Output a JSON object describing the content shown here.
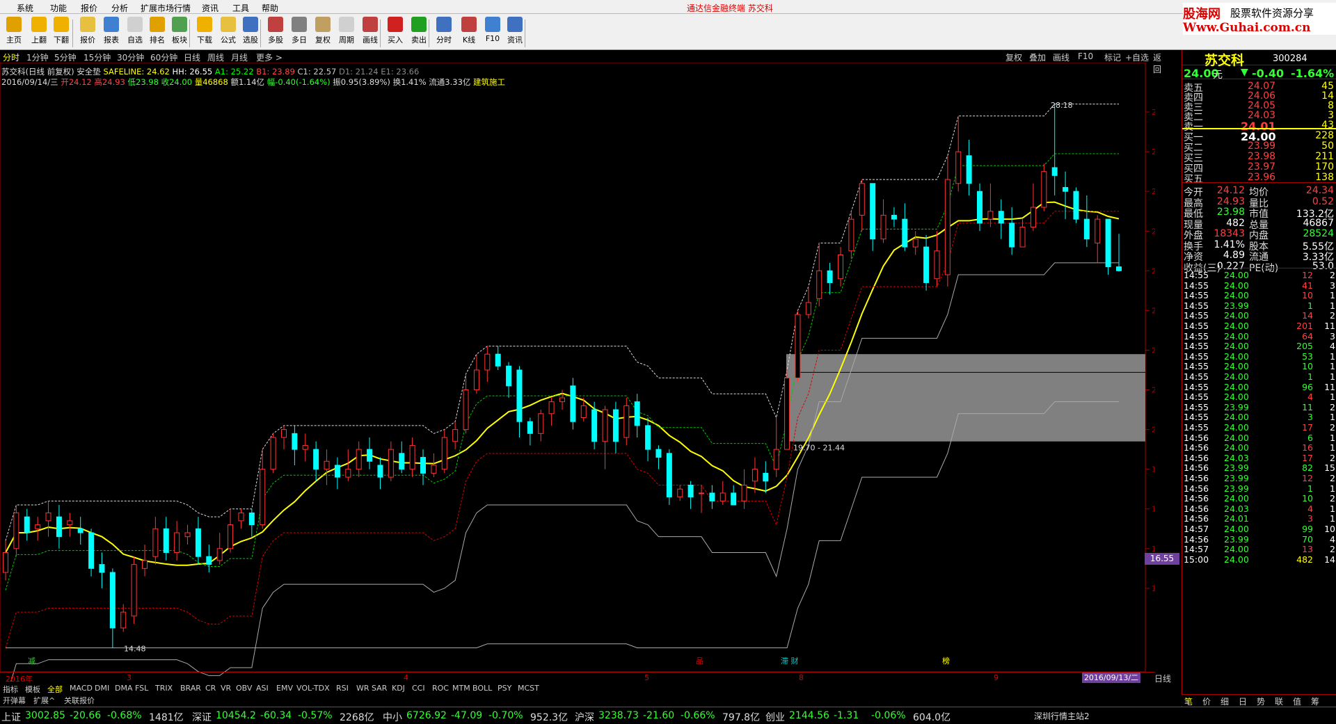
{
  "menu": [
    "系统",
    "功能",
    "报价",
    "分析",
    "扩展市场行情",
    "资讯",
    "工具",
    "帮助"
  ],
  "window_title": "通达信金融终端    苏交科",
  "toolbar": [
    {
      "label": "主页",
      "icon": "home-icon",
      "color": "#e0a000"
    },
    {
      "label": "上翻",
      "icon": "arrow-up-icon",
      "color": "#f0b000"
    },
    {
      "label": "下翻",
      "icon": "arrow-down-icon",
      "color": "#f0b000"
    },
    {
      "label": "报价",
      "icon": "yen-icon",
      "color": "#e8c040"
    },
    {
      "label": "报表",
      "icon": "report-icon",
      "color": "#4080d0"
    },
    {
      "label": "自选",
      "icon": "f6-icon",
      "color": "#d0d0d0"
    },
    {
      "label": "排名",
      "icon": "rank-icon",
      "color": "#e0a000"
    },
    {
      "label": "板块",
      "icon": "blocks-icon",
      "color": "#50a050"
    },
    {
      "label": "下载",
      "icon": "download-icon",
      "color": "#f0b000"
    },
    {
      "label": "公式",
      "icon": "formula-icon",
      "color": "#e8c040"
    },
    {
      "label": "选股",
      "icon": "select-stock-icon",
      "color": "#4070c0"
    },
    {
      "label": "多股",
      "icon": "multi-stock-icon",
      "color": "#c04040"
    },
    {
      "label": "多日",
      "icon": "multi-day-icon",
      "color": "#808080"
    },
    {
      "label": "复权",
      "icon": "adjust-icon",
      "color": "#c0a060"
    },
    {
      "label": "周期",
      "icon": "f8-icon",
      "color": "#d0d0d0"
    },
    {
      "label": "画线",
      "icon": "draw-line-icon",
      "color": "#c04040"
    },
    {
      "label": "买入",
      "icon": "buy-icon",
      "color": "#d02020"
    },
    {
      "label": "卖出",
      "icon": "sell-icon",
      "color": "#20a020"
    },
    {
      "label": "分时",
      "icon": "intraday-icon",
      "color": "#4070c0"
    },
    {
      "label": "K线",
      "icon": "kline-icon",
      "color": "#c04040"
    },
    {
      "label": "F10",
      "icon": "f10-icon",
      "color": "#4080d0"
    },
    {
      "label": "资讯",
      "icon": "news-icon",
      "color": "#4070c0"
    }
  ],
  "logo": {
    "line1": "股海网",
    "line1b": "股票软件资源分享",
    "line2": "Www.Guhai.com.cn"
  },
  "periods": [
    "分时",
    "1分钟",
    "5分钟",
    "15分钟",
    "30分钟",
    "60分钟",
    "日线",
    "周线",
    "月线",
    "更多 >"
  ],
  "active_period": "分时",
  "right_tools": [
    "复权",
    "叠加",
    "画线",
    "F10",
    "标记",
    "+自选",
    "返回"
  ],
  "info": {
    "line1_name": "苏交科(日线 前复权) 安全垫",
    "line1_safeline": "SAFELINE: 24.62",
    "line1_hh": "HH: 26.55",
    "line1_a1": "A1: 25.22",
    "line1_b1": "B1: 23.89",
    "line1_c1": "C1: 22.57",
    "line1_d1": "D1: 21.24",
    "line1_e1": "E1: 23.66",
    "line2_date": "2016/09/14/三",
    "line2_open": "开24.12",
    "line2_high": "高24.93",
    "line2_low": "低23.98",
    "line2_close": "收24.00",
    "line2_vol": "量46868",
    "line2_amt": "额1.14亿",
    "line2_chg": "幅-0.40(-1.64%)",
    "line2_amp": "振0.95(3.89%)",
    "line2_turn": "换1.41%",
    "line2_float": "流通3.33亿",
    "line2_sector": "建筑施工"
  },
  "chart_data": {
    "type": "candlestick",
    "ylim": [
      14,
      29
    ],
    "y_ticks": [
      "16.00",
      "17.00",
      "18.00",
      "19.00",
      "20.00",
      "21.00",
      "22.00",
      "23.00",
      "24.00",
      "25.00",
      "26.00",
      "27.00",
      "28.00"
    ],
    "annotations": [
      "28.18",
      "14.48",
      "19.70 - 21.44"
    ],
    "current_price_tag": "16.55",
    "x_labels": [
      "2016年",
      "3",
      "4",
      "5",
      "8",
      "9"
    ],
    "event_marks": [
      "减",
      "品",
      "滞 财",
      "榜"
    ],
    "end_date": "2016/09/13/二",
    "candles": [
      [
        16.4,
        16.9,
        16.2,
        17.2
      ],
      [
        17.0,
        17.9,
        16.8,
        18.1
      ],
      [
        17.8,
        17.4,
        17.2,
        18.0
      ],
      [
        17.5,
        17.6,
        17.2,
        17.8
      ],
      [
        17.7,
        17.9,
        17.3,
        18.2
      ],
      [
        17.8,
        17.3,
        17.0,
        18.1
      ],
      [
        17.6,
        17.7,
        17.3,
        17.9
      ],
      [
        17.5,
        17.4,
        17.1,
        17.8
      ],
      [
        17.4,
        16.5,
        16.3,
        17.5
      ],
      [
        16.6,
        16.4,
        16.0,
        16.9
      ],
      [
        16.4,
        15.0,
        14.5,
        16.5
      ],
      [
        15.0,
        15.4,
        14.9,
        15.6
      ],
      [
        15.3,
        16.6,
        15.1,
        16.8
      ],
      [
        16.5,
        16.7,
        16.3,
        17.1
      ],
      [
        16.8,
        17.5,
        16.6,
        17.8
      ],
      [
        17.5,
        16.9,
        16.7,
        17.8
      ],
      [
        16.9,
        17.4,
        16.7,
        17.7
      ],
      [
        17.3,
        17.4,
        17.1,
        17.6
      ],
      [
        17.5,
        16.8,
        16.6,
        17.8
      ],
      [
        16.8,
        16.6,
        16.4,
        17.1
      ],
      [
        16.7,
        17.0,
        16.6,
        17.4
      ],
      [
        17.0,
        17.6,
        16.9,
        18.0
      ],
      [
        17.7,
        17.9,
        17.5,
        18.0
      ],
      [
        17.9,
        17.6,
        17.3,
        18.0
      ],
      [
        17.6,
        19.0,
        17.5,
        19.5
      ],
      [
        19.0,
        19.8,
        18.9,
        19.9
      ],
      [
        19.8,
        20.0,
        19.5,
        20.1
      ],
      [
        19.9,
        19.5,
        19.1,
        20.1
      ],
      [
        19.5,
        19.6,
        19.2,
        19.9
      ],
      [
        19.5,
        19.0,
        18.7,
        19.7
      ],
      [
        19.0,
        19.2,
        18.6,
        19.5
      ],
      [
        19.1,
        18.8,
        18.5,
        19.3
      ],
      [
        18.8,
        19.0,
        18.7,
        19.5
      ],
      [
        19.0,
        19.5,
        18.8,
        19.7
      ],
      [
        19.5,
        19.2,
        19.0,
        19.8
      ],
      [
        19.1,
        18.8,
        18.5,
        19.3
      ],
      [
        18.8,
        19.5,
        18.7,
        19.7
      ],
      [
        19.4,
        19.0,
        18.9,
        19.7
      ],
      [
        19.0,
        19.6,
        18.8,
        19.8
      ],
      [
        19.3,
        18.9,
        18.6,
        19.5
      ],
      [
        18.9,
        19.1,
        18.8,
        19.4
      ],
      [
        19.0,
        19.8,
        18.9,
        20.0
      ],
      [
        19.7,
        20.0,
        19.5,
        20.2
      ],
      [
        20.0,
        21.0,
        19.9,
        21.4
      ],
      [
        21.0,
        21.5,
        20.9,
        21.9
      ],
      [
        21.5,
        21.9,
        21.2,
        22.1
      ],
      [
        21.9,
        21.6,
        21.5,
        22.1
      ],
      [
        21.6,
        21.1,
        20.8,
        21.7
      ],
      [
        21.5,
        20.2,
        19.8,
        21.6
      ],
      [
        20.2,
        19.9,
        19.6,
        20.3
      ],
      [
        19.9,
        20.4,
        19.7,
        20.5
      ],
      [
        20.4,
        20.7,
        20.1,
        20.8
      ],
      [
        20.7,
        20.8,
        20.5,
        21.0
      ],
      [
        21.1,
        20.2,
        20.0,
        21.3
      ],
      [
        20.3,
        20.6,
        20.2,
        20.8
      ],
      [
        20.5,
        19.7,
        19.5,
        20.7
      ],
      [
        19.7,
        20.5,
        19.0,
        20.6
      ],
      [
        20.5,
        19.7,
        19.4,
        20.7
      ],
      [
        19.8,
        20.6,
        19.6,
        20.8
      ],
      [
        20.7,
        20.1,
        19.8,
        20.9
      ],
      [
        20.1,
        19.5,
        19.2,
        20.3
      ],
      [
        19.5,
        19.3,
        19.0,
        19.6
      ],
      [
        19.4,
        18.3,
        18.1,
        19.5
      ],
      [
        18.3,
        18.5,
        18.2,
        18.6
      ],
      [
        18.6,
        18.3,
        18.0,
        18.7
      ],
      [
        18.4,
        18.4,
        17.9,
        18.6
      ],
      [
        18.4,
        18.2,
        18.0,
        18.6
      ],
      [
        18.2,
        18.4,
        18.1,
        18.7
      ],
      [
        18.4,
        18.1,
        18.1,
        18.6
      ],
      [
        18.2,
        18.6,
        18.0,
        19.0
      ],
      [
        18.7,
        19.0,
        18.4,
        19.3
      ],
      [
        18.9,
        18.7,
        18.4,
        19.2
      ],
      [
        19.0,
        19.5,
        18.8,
        20.3
      ],
      [
        19.5,
        21.3,
        19.5,
        21.5
      ],
      [
        21.3,
        22.9,
        21.2,
        23.0
      ],
      [
        22.9,
        23.2,
        22.8,
        23.6
      ],
      [
        23.3,
        24.0,
        23.1,
        24.7
      ],
      [
        24.0,
        23.7,
        23.4,
        24.2
      ],
      [
        23.8,
        24.4,
        23.6,
        24.6
      ],
      [
        24.5,
        25.3,
        24.3,
        25.5
      ],
      [
        25.4,
        26.2,
        25.0,
        26.3
      ],
      [
        26.2,
        24.8,
        24.5,
        26.2
      ],
      [
        24.8,
        25.4,
        24.7,
        25.8
      ],
      [
        25.4,
        25.3,
        25.1,
        25.6
      ],
      [
        25.3,
        24.6,
        24.5,
        25.7
      ],
      [
        24.6,
        24.8,
        24.4,
        25.0
      ],
      [
        24.6,
        23.7,
        23.5,
        24.9
      ],
      [
        23.8,
        24.5,
        23.6,
        25.0
      ],
      [
        23.9,
        26.3,
        23.6,
        26.9
      ],
      [
        26.2,
        27.0,
        26.0,
        27.9
      ],
      [
        26.9,
        26.2,
        25.9,
        27.3
      ],
      [
        26.0,
        25.2,
        25.0,
        26.2
      ],
      [
        25.3,
        25.5,
        25.1,
        26.2
      ],
      [
        25.5,
        25.2,
        24.8,
        25.8
      ],
      [
        25.2,
        24.6,
        24.4,
        25.6
      ],
      [
        24.6,
        25.1,
        24.6,
        25.3
      ],
      [
        25.1,
        25.6,
        25.0,
        26.2
      ],
      [
        25.6,
        26.5,
        25.5,
        26.7
      ],
      [
        26.6,
        26.4,
        25.9,
        28.2
      ],
      [
        26.1,
        26.0,
        25.3,
        26.5
      ],
      [
        26.0,
        25.3,
        25.2,
        26.1
      ],
      [
        25.3,
        24.8,
        24.6,
        25.9
      ],
      [
        24.7,
        25.3,
        24.2,
        25.4
      ],
      [
        25.3,
        24.1,
        23.9,
        25.3
      ],
      [
        24.1,
        24.0,
        23.98,
        24.93
      ]
    ]
  },
  "indicators": [
    "指标",
    "模板",
    "全部",
    "MACD",
    "DMI",
    "DMA",
    "FSL",
    "TRIX",
    "BRAR",
    "CR",
    "VR",
    "OBV",
    "ASI",
    "EMV",
    "VOL-TDX",
    "RSI",
    "WR",
    "SAR",
    "KDJ",
    "CCI",
    "ROC",
    "MTM",
    "BOLL",
    "PSY",
    "MCST"
  ],
  "tabs2": [
    "开弹幕",
    "扩展^",
    "关联报价"
  ],
  "status": [
    {
      "name": "上证",
      "val": "3002.85",
      "chg": "-20.66",
      "pct": "-0.68%",
      "amt": "1481亿"
    },
    {
      "name": "深证",
      "val": "10454.2",
      "chg": "-60.34",
      "pct": "-0.57%",
      "amt": "2268亿"
    },
    {
      "name": "中小",
      "val": "6726.92",
      "chg": "-47.09",
      "pct": "-0.70%",
      "amt": "952.3亿"
    },
    {
      "name": "沪深",
      "val": "3238.73",
      "chg": "-21.60",
      "pct": "-0.66%",
      "amt": "797.8亿"
    },
    {
      "name": "创业",
      "val": "2144.56",
      "chg": "-1.31",
      "pct": "-0.06%",
      "amt": "604.0亿"
    }
  ],
  "server": "深圳行情主站2",
  "stock": {
    "name": "苏交科",
    "code": "300284",
    "price": "24.00",
    "unit": "元",
    "chg": "-0.40",
    "pct": "-1.64%"
  },
  "asks": [
    {
      "label": "卖五",
      "price": "24.07",
      "vol": "45"
    },
    {
      "label": "卖四",
      "price": "24.06",
      "vol": "14"
    },
    {
      "label": "卖三",
      "price": "24.05",
      "vol": "8"
    },
    {
      "label": "卖二",
      "price": "24.03",
      "vol": "3"
    },
    {
      "label": "卖一",
      "price": "24.01",
      "vol": "43"
    }
  ],
  "bids": [
    {
      "label": "买一",
      "price": "24.00",
      "vol": "228"
    },
    {
      "label": "买二",
      "price": "23.99",
      "vol": "50"
    },
    {
      "label": "买三",
      "price": "23.98",
      "vol": "211"
    },
    {
      "label": "买四",
      "price": "23.97",
      "vol": "170"
    },
    {
      "label": "买五",
      "price": "23.96",
      "vol": "138"
    }
  ],
  "stats": [
    {
      "l1": "今开",
      "v1": "24.12",
      "c1": "red",
      "l2": "均价",
      "v2": "24.34",
      "c2": "red"
    },
    {
      "l1": "最高",
      "v1": "24.93",
      "c1": "red",
      "l2": "量比",
      "v2": "0.52",
      "c2": "red"
    },
    {
      "l1": "最低",
      "v1": "23.98",
      "c1": "grn",
      "l2": "市值",
      "v2": "133.2亿",
      "c2": "wht"
    },
    {
      "l1": "现量",
      "v1": "482",
      "c1": "wht",
      "l2": "总量",
      "v2": "46867",
      "c2": "wht"
    },
    {
      "l1": "外盘",
      "v1": "18343",
      "c1": "red",
      "l2": "内盘",
      "v2": "28524",
      "c2": "grn"
    },
    {
      "l1": "换手",
      "v1": "1.41%",
      "c1": "wht",
      "l2": "股本",
      "v2": "5.55亿",
      "c2": "wht"
    },
    {
      "l1": "净资",
      "v1": "4.89",
      "c1": "wht",
      "l2": "流通",
      "v2": "3.33亿",
      "c2": "wht"
    },
    {
      "l1": "收益(三)",
      "v1": "0.227",
      "c1": "wht",
      "l2": "PE(动)",
      "v2": "53.0",
      "c2": "wht"
    }
  ],
  "ticks": [
    [
      "14:55",
      "24.00",
      "12",
      "2",
      "grn",
      "red"
    ],
    [
      "14:55",
      "24.00",
      "41",
      "3",
      "grn",
      "red"
    ],
    [
      "14:55",
      "24.00",
      "10",
      "1",
      "grn",
      "red"
    ],
    [
      "14:55",
      "23.99",
      "1",
      "1",
      "grn",
      "grn"
    ],
    [
      "14:55",
      "24.00",
      "14",
      "2",
      "grn",
      "red"
    ],
    [
      "14:55",
      "24.00",
      "201",
      "11",
      "grn",
      "red"
    ],
    [
      "14:55",
      "24.00",
      "64",
      "3",
      "grn",
      "red"
    ],
    [
      "14:55",
      "24.00",
      "205",
      "4",
      "grn",
      "grn"
    ],
    [
      "14:55",
      "24.00",
      "53",
      "1",
      "grn",
      "grn"
    ],
    [
      "14:55",
      "24.00",
      "10",
      "1",
      "grn",
      "grn"
    ],
    [
      "14:55",
      "24.00",
      "1",
      "1",
      "grn",
      "grn"
    ],
    [
      "14:55",
      "24.00",
      "96",
      "11",
      "grn",
      "grn"
    ],
    [
      "14:55",
      "24.00",
      "4",
      "1",
      "grn",
      "red"
    ],
    [
      "14:55",
      "23.99",
      "11",
      "2",
      "grn",
      "grn"
    ],
    [
      "14:55",
      "24.00",
      "3",
      "1",
      "grn",
      "grn"
    ],
    [
      "14:55",
      "24.00",
      "17",
      "2",
      "grn",
      "red"
    ],
    [
      "14:56",
      "24.00",
      "6",
      "1",
      "grn",
      "grn"
    ],
    [
      "14:56",
      "24.00",
      "16",
      "1",
      "grn",
      "red"
    ],
    [
      "14:56",
      "24.03",
      "17",
      "2",
      "grn",
      "red"
    ],
    [
      "14:56",
      "23.99",
      "82",
      "15",
      "grn",
      "grn"
    ],
    [
      "14:56",
      "23.99",
      "12",
      "2",
      "grn",
      "red"
    ],
    [
      "14:56",
      "23.99",
      "1",
      "1",
      "grn",
      "grn"
    ],
    [
      "14:56",
      "24.00",
      "10",
      "2",
      "grn",
      "grn"
    ],
    [
      "14:56",
      "24.03",
      "4",
      "1",
      "grn",
      "red"
    ],
    [
      "14:56",
      "24.01",
      "3",
      "1",
      "grn",
      "red"
    ],
    [
      "14:57",
      "24.00",
      "99",
      "10",
      "grn",
      "grn"
    ],
    [
      "14:56",
      "23.99",
      "70",
      "4",
      "grn",
      "grn"
    ],
    [
      "14:57",
      "24.00",
      "13",
      "2",
      "grn",
      "red"
    ],
    [
      "15:00",
      "24.00",
      "482",
      "14",
      "grn",
      "yel"
    ]
  ],
  "bottom_tabs": [
    "笔",
    "价",
    "细",
    "日",
    "势",
    "联",
    "值",
    "筹"
  ]
}
